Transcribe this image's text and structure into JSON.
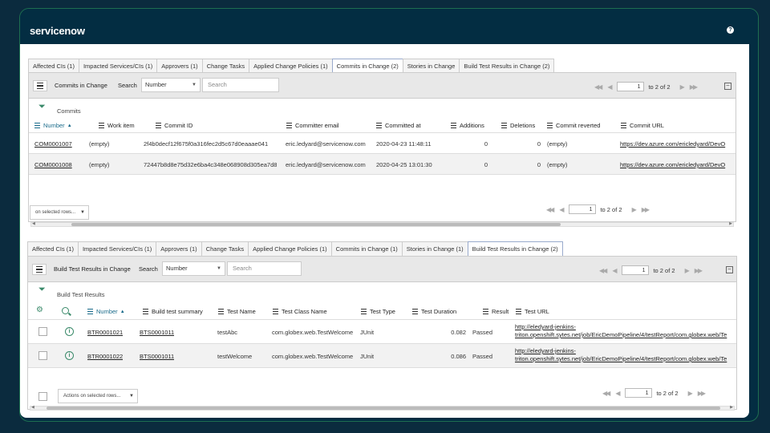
{
  "app": {
    "logo": "servicenow",
    "help_icon": "help-icon"
  },
  "top": {
    "tabs": [
      "Affected CIs (1)",
      "Impacted Services/CIs (1)",
      "Approvers (1)",
      "Change Tasks",
      "Applied Change Policies (1)",
      "Commits in Change (2)",
      "Stories in Change",
      "Build Test Results in Change (2)"
    ],
    "active_tab": 5,
    "title": "Commits in Change",
    "search_label": "Search",
    "search_field": "Number",
    "search_placeholder": "Search",
    "page": "1",
    "page_text": "to 2 of 2",
    "breadcrumb": "Commits",
    "columns": [
      "Number",
      "Work item",
      "Commit ID",
      "Committer email",
      "Committed at",
      "Additions",
      "Deletions",
      "Commit reverted",
      "Commit URL"
    ],
    "rows": [
      [
        "COM0001007",
        "(empty)",
        "2f4b0decf12f675f0a316fec2d5c67d0eaaae041",
        "eric.ledyard@servicenow.com",
        "2020-04-23 11:48:11",
        "0",
        "0",
        "(empty)",
        "https://dev.azure.com/ericledyard/DevO"
      ],
      [
        "COM0001008",
        "(empty)",
        "72447b8d8e75d32e6ba4c348e068908d305ea7d8",
        "eric.ledyard@servicenow.com",
        "2020-04-25 13:01:30",
        "0",
        "0",
        "(empty)",
        "https://dev.azure.com/ericledyard/DevO"
      ]
    ],
    "actions_label": "on selected rows...",
    "bottom_page": "1",
    "bottom_page_text": "to 2 of 2"
  },
  "bottom": {
    "tabs": [
      "Affected CIs (1)",
      "Impacted Services/CIs (1)",
      "Approvers (1)",
      "Change Tasks",
      "Applied Change Policies (1)",
      "Commits in Change (1)",
      "Stories in Change (1)",
      "Build Test Results in Change (2)"
    ],
    "active_tab": 7,
    "title": "Build Test Results in Change",
    "search_label": "Search",
    "search_field": "Number",
    "search_placeholder": "Search",
    "page": "1",
    "page_text": "to 2 of 2",
    "breadcrumb": "Build Test Results",
    "columns": [
      "Number",
      "Build test summary",
      "Test Name",
      "Test Class Name",
      "Test Type",
      "Test Duration",
      "Result",
      "Test URL"
    ],
    "rows": [
      [
        "BTR0001021",
        "BTS0001011",
        "testAbc",
        "com.globex.web.TestWelcome",
        "JUnit",
        "0.082",
        "Passed",
        "http://eledyard-jenkins-",
        "triton.openshift.sytes.net/job/EricDemoPipeline/4/testReport/com.globex.web/Te"
      ],
      [
        "BTR0001022",
        "BTS0001011",
        "testWelcome",
        "com.globex.web.TestWelcome",
        "JUnit",
        "0.086",
        "Passed",
        "http://eledyard-jenkins-",
        "triton.openshift.sytes.net/job/EricDemoPipeline/4/testReport/com.globex.web/Te"
      ]
    ],
    "actions_label": "Actions on selected rows...",
    "bottom_page": "1",
    "bottom_page_text": "to 2 of 2"
  }
}
